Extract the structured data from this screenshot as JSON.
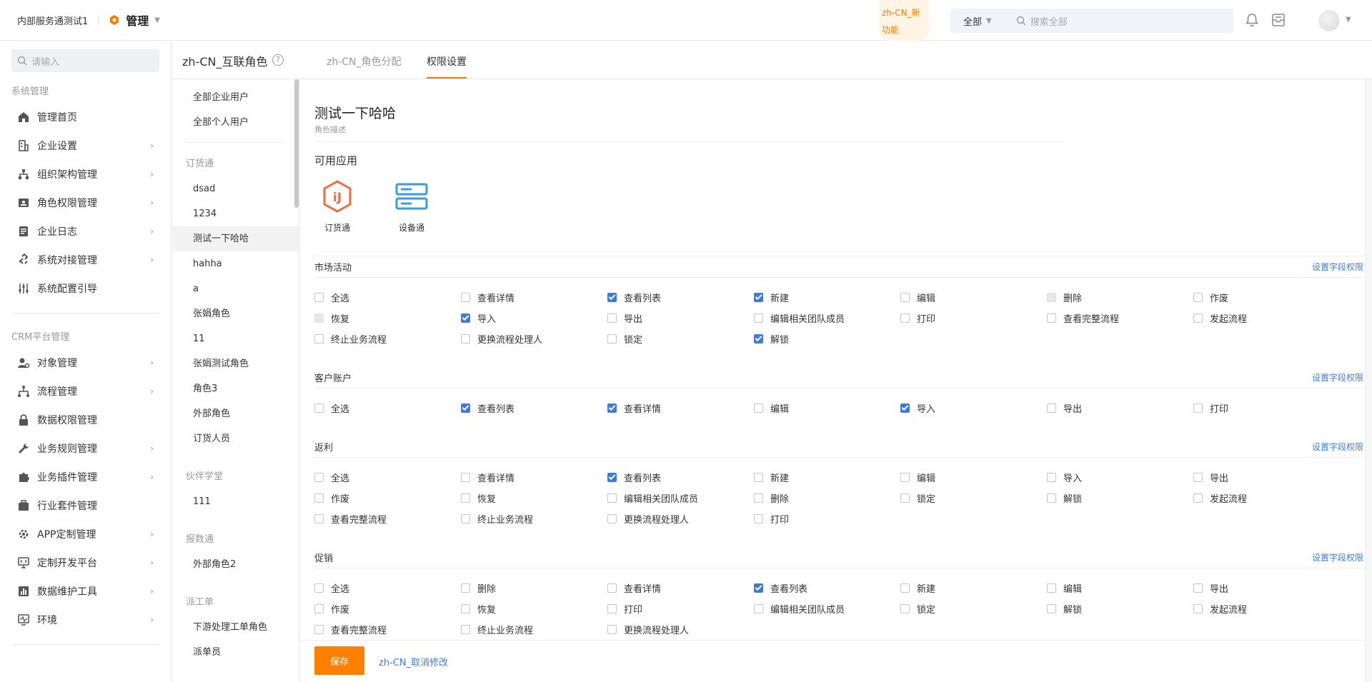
{
  "topbar": {
    "company": "内部服务通测试1",
    "app_name": "管理",
    "new_feature": "zh-CN_新功能",
    "search_scope": "全部",
    "search_placeholder": "搜索全部"
  },
  "sidebar": {
    "search_placeholder": "请输入",
    "group1": "系统管理",
    "group1_items": [
      {
        "label": "管理首页",
        "icon": "home-icon",
        "chevron": false
      },
      {
        "label": "企业设置",
        "icon": "building-icon",
        "chevron": true
      },
      {
        "label": "组织架构管理",
        "icon": "org-chart-icon",
        "chevron": true
      },
      {
        "label": "角色权限管理",
        "icon": "id-card-icon",
        "chevron": true
      },
      {
        "label": "企业日志",
        "icon": "log-icon",
        "chevron": true
      },
      {
        "label": "系统对接管理",
        "icon": "link-icon",
        "chevron": true
      },
      {
        "label": "系统配置引导",
        "icon": "sliders-icon",
        "chevron": false
      }
    ],
    "group2": "CRM平台管理",
    "group2_items": [
      {
        "label": "对象管理",
        "icon": "user-gear-icon",
        "chevron": true
      },
      {
        "label": "流程管理",
        "icon": "flow-icon",
        "chevron": true
      },
      {
        "label": "数据权限管理",
        "icon": "lock-icon",
        "chevron": false
      },
      {
        "label": "业务规则管理",
        "icon": "wrench-icon",
        "chevron": true
      },
      {
        "label": "业务插件管理",
        "icon": "puzzle-icon",
        "chevron": true
      },
      {
        "label": "行业套件管理",
        "icon": "suitcase-icon",
        "chevron": false
      },
      {
        "label": "APP定制管理",
        "icon": "app-gear-icon",
        "chevron": true
      },
      {
        "label": "定制开发平台",
        "icon": "monitor-code-icon",
        "chevron": true
      },
      {
        "label": "数据维护工具",
        "icon": "bar-chart-icon",
        "chevron": true
      },
      {
        "label": "环境",
        "icon": "pulse-monitor-icon",
        "chevron": true
      }
    ]
  },
  "header": {
    "role_title": "zh-CN_互联角色",
    "help": "?",
    "tab1": "zh-CN_角色分配",
    "tab2": "权限设置"
  },
  "rolelist": {
    "all_enterprise": "全部企业用户",
    "all_personal": "全部个人用户",
    "groups": [
      {
        "name": "订货通",
        "items": [
          "dsad",
          "1234",
          "测试一下哈哈",
          "hahha",
          "a",
          "张娟角色",
          "11",
          "张娟测试角色",
          "角色3",
          "外部角色",
          "订货人员"
        ]
      },
      {
        "name": "伙伴学堂",
        "items": [
          "111"
        ]
      },
      {
        "name": "报数通",
        "items": [
          "外部角色2"
        ]
      },
      {
        "name": "派工单",
        "items": [
          "下游处理工单角色",
          "派单员"
        ]
      }
    ],
    "selected": "测试一下哈哈"
  },
  "main": {
    "role_name": "测试一下哈哈",
    "role_desc": "角色描述",
    "apps_title": "可用应用",
    "apps": [
      {
        "label": "订货通",
        "icon": "order-hex-icon",
        "color": "#f26b3a"
      },
      {
        "label": "设备通",
        "icon": "server-icon",
        "color": "#3a9be8"
      }
    ],
    "field_perm_link": "设置字段权限",
    "sections": [
      {
        "title": "市场活动",
        "perms": [
          {
            "label": "全选",
            "state": "off"
          },
          {
            "label": "查看详情",
            "state": "off"
          },
          {
            "label": "查看列表",
            "state": "on"
          },
          {
            "label": "新建",
            "state": "on"
          },
          {
            "label": "编辑",
            "state": "off"
          },
          {
            "label": "删除",
            "state": "disabled"
          },
          {
            "label": "作废",
            "state": "off"
          },
          {
            "label": "恢复",
            "state": "disabled"
          },
          {
            "label": "导入",
            "state": "on"
          },
          {
            "label": "导出",
            "state": "off"
          },
          {
            "label": "编辑相关团队成员",
            "state": "off"
          },
          {
            "label": "打印",
            "state": "off"
          },
          {
            "label": "查看完整流程",
            "state": "off"
          },
          {
            "label": "发起流程",
            "state": "off"
          },
          {
            "label": "终止业务流程",
            "state": "off"
          },
          {
            "label": "更换流程处理人",
            "state": "off"
          },
          {
            "label": "锁定",
            "state": "off"
          },
          {
            "label": "解锁",
            "state": "on"
          }
        ]
      },
      {
        "title": "客户账户",
        "perms": [
          {
            "label": "全选",
            "state": "off"
          },
          {
            "label": "查看列表",
            "state": "on"
          },
          {
            "label": "查看详情",
            "state": "on"
          },
          {
            "label": "编辑",
            "state": "off"
          },
          {
            "label": "导入",
            "state": "on"
          },
          {
            "label": "导出",
            "state": "off"
          },
          {
            "label": "打印",
            "state": "off"
          }
        ]
      },
      {
        "title": "返利",
        "perms": [
          {
            "label": "全选",
            "state": "off"
          },
          {
            "label": "查看详情",
            "state": "off"
          },
          {
            "label": "查看列表",
            "state": "on"
          },
          {
            "label": "新建",
            "state": "off"
          },
          {
            "label": "编辑",
            "state": "off"
          },
          {
            "label": "导入",
            "state": "off"
          },
          {
            "label": "导出",
            "state": "off"
          },
          {
            "label": "作废",
            "state": "off"
          },
          {
            "label": "恢复",
            "state": "off"
          },
          {
            "label": "编辑相关团队成员",
            "state": "off"
          },
          {
            "label": "删除",
            "state": "off"
          },
          {
            "label": "锁定",
            "state": "off"
          },
          {
            "label": "解锁",
            "state": "off"
          },
          {
            "label": "发起流程",
            "state": "off"
          },
          {
            "label": "查看完整流程",
            "state": "off"
          },
          {
            "label": "终止业务流程",
            "state": "off"
          },
          {
            "label": "更换流程处理人",
            "state": "off"
          },
          {
            "label": "打印",
            "state": "off"
          }
        ]
      },
      {
        "title": "促销",
        "perms": [
          {
            "label": "全选",
            "state": "off"
          },
          {
            "label": "删除",
            "state": "off"
          },
          {
            "label": "查看详情",
            "state": "off"
          },
          {
            "label": "查看列表",
            "state": "on"
          },
          {
            "label": "新建",
            "state": "off"
          },
          {
            "label": "编辑",
            "state": "off"
          },
          {
            "label": "导出",
            "state": "off"
          },
          {
            "label": "作废",
            "state": "off"
          },
          {
            "label": "恢复",
            "state": "off"
          },
          {
            "label": "打印",
            "state": "off"
          },
          {
            "label": "编辑相关团队成员",
            "state": "off"
          },
          {
            "label": "锁定",
            "state": "off"
          },
          {
            "label": "解锁",
            "state": "off"
          },
          {
            "label": "发起流程",
            "state": "off"
          },
          {
            "label": "查看完整流程",
            "state": "off"
          },
          {
            "label": "终止业务流程",
            "state": "off"
          },
          {
            "label": "更换流程处理人",
            "state": "off"
          }
        ]
      }
    ]
  },
  "footer": {
    "save": "保存",
    "cancel": "zh-CN_取消修改"
  },
  "colors": {
    "accent": "#ff8000",
    "link": "#3d7bd9",
    "checkbox_on": "#3d7bd9"
  }
}
